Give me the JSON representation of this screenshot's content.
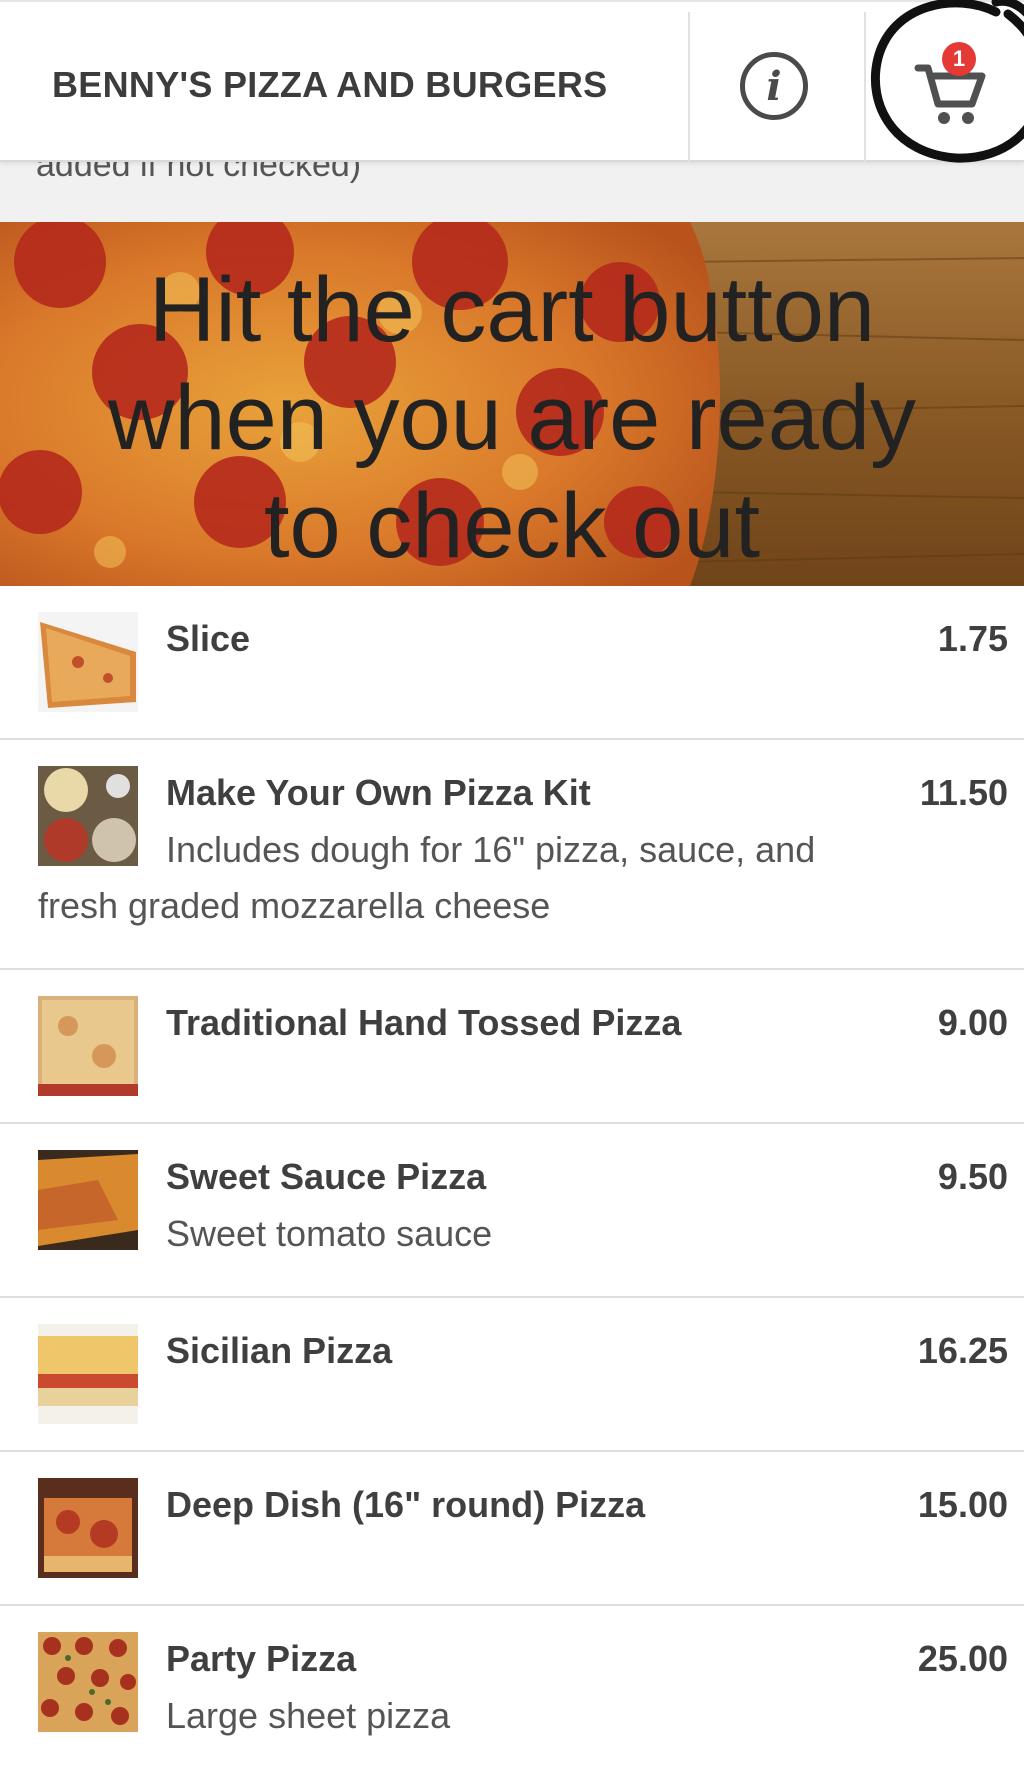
{
  "header": {
    "title": "BENNY'S PIZZA AND BURGERS",
    "info_icon": "info-icon",
    "cart_icon": "cart-icon",
    "cart_count": "1"
  },
  "partial_text": "added if not checked)",
  "banner": {
    "line1": "Hit the cart button",
    "line2": "when you are ready",
    "line3": "to check out"
  },
  "menu": {
    "items": [
      {
        "name": "Slice",
        "price": "1.75",
        "desc": ""
      },
      {
        "name": "Make Your Own Pizza Kit",
        "price": "11.50",
        "desc_line1": "Includes dough for 16\" pizza, sauce, and",
        "desc_line2": "fresh graded mozzarella cheese"
      },
      {
        "name": "Traditional Hand Tossed Pizza",
        "price": "9.00",
        "desc": ""
      },
      {
        "name": "Sweet Sauce Pizza",
        "price": "9.50",
        "desc": "Sweet tomato sauce"
      },
      {
        "name": "Sicilian Pizza",
        "price": "16.25",
        "desc": ""
      },
      {
        "name": "Deep Dish (16\" round) Pizza",
        "price": "15.00",
        "desc": ""
      },
      {
        "name": "Party Pizza",
        "price": "25.00",
        "desc": "Large sheet pizza"
      }
    ]
  },
  "colors": {
    "badge": "#e53935",
    "text": "#3f3f3f"
  }
}
